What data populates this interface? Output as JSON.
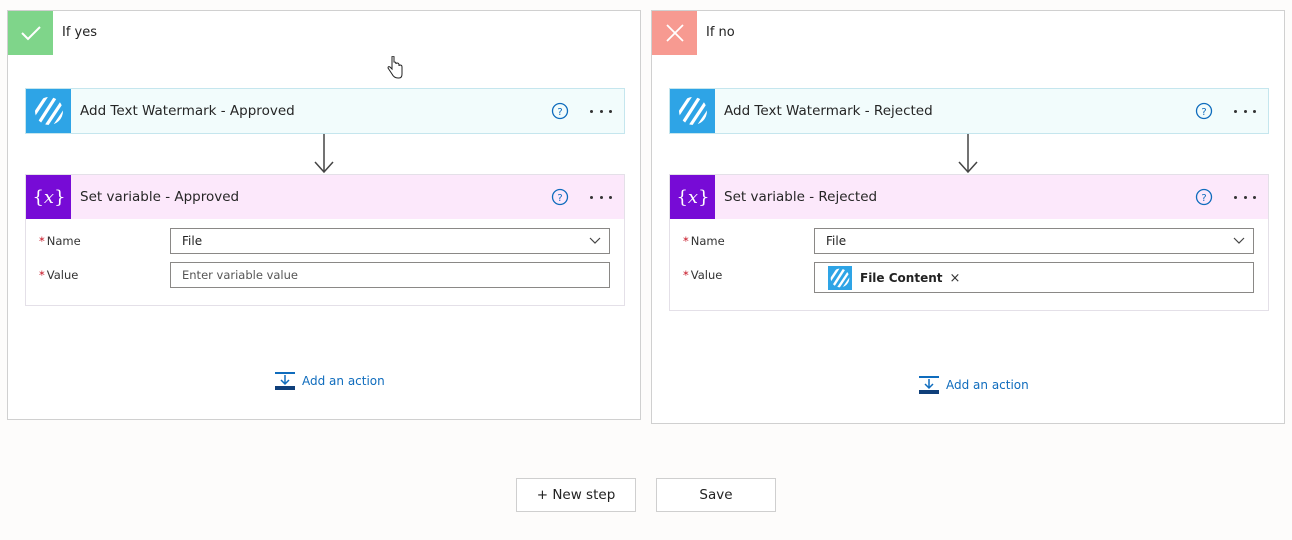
{
  "colors": {
    "yes_badge": "#7fd58a",
    "no_badge": "#f79a91",
    "watermark_icon": "#2ea4e6",
    "variable_icon": "#770bd6",
    "link": "#0f6cbd"
  },
  "branch_yes": {
    "title": "If yes",
    "badge_icon": "checkmark-icon",
    "watermark_card": {
      "title": "Add Text Watermark - Approved",
      "icon": "watermark-stripes-icon"
    },
    "variable_card": {
      "title": "Set variable - Approved",
      "icon": "variable-braces-icon",
      "name_label": "Name",
      "name_value": "File",
      "value_label": "Value",
      "value_placeholder": "Enter variable value"
    },
    "add_action": "Add an action"
  },
  "branch_no": {
    "title": "If no",
    "badge_icon": "close-icon",
    "watermark_card": {
      "title": "Add Text Watermark - Rejected",
      "icon": "watermark-stripes-icon"
    },
    "variable_card": {
      "title": "Set variable - Rejected",
      "icon": "variable-braces-icon",
      "name_label": "Name",
      "name_value": "File",
      "value_label": "Value",
      "value_token": "File Content",
      "token_remove": "×"
    },
    "add_action": "Add an action"
  },
  "footer": {
    "new_step": "+ New step",
    "save": "Save"
  }
}
